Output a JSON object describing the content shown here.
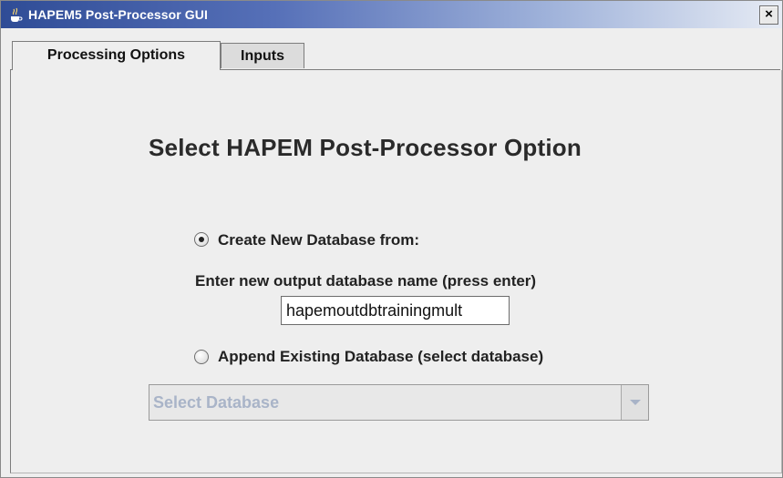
{
  "window": {
    "title": "HAPEM5 Post-Processor GUI",
    "close_glyph": "×",
    "icon": "java-cup-icon"
  },
  "tabs": [
    {
      "label": "Processing Options",
      "active": true
    },
    {
      "label": "Inputs",
      "active": false
    }
  ],
  "main": {
    "heading": "Select HAPEM Post-Processor Option",
    "option_create": {
      "label": "Create New Database from:",
      "selected": true
    },
    "db_name_prompt": "Enter new output database name (press enter)",
    "db_name_value": "hapemoutdbtrainingmult",
    "option_append": {
      "label": "Append Existing Database (select database)",
      "selected": false
    },
    "database_select": {
      "selected_text": "Select Database",
      "enabled": false
    }
  },
  "colors": {
    "titlebar_start": "#2f4c96",
    "titlebar_end": "#e6ebf4",
    "panel_bg": "#eeeeee",
    "disabled_text": "#a9b4c8"
  }
}
